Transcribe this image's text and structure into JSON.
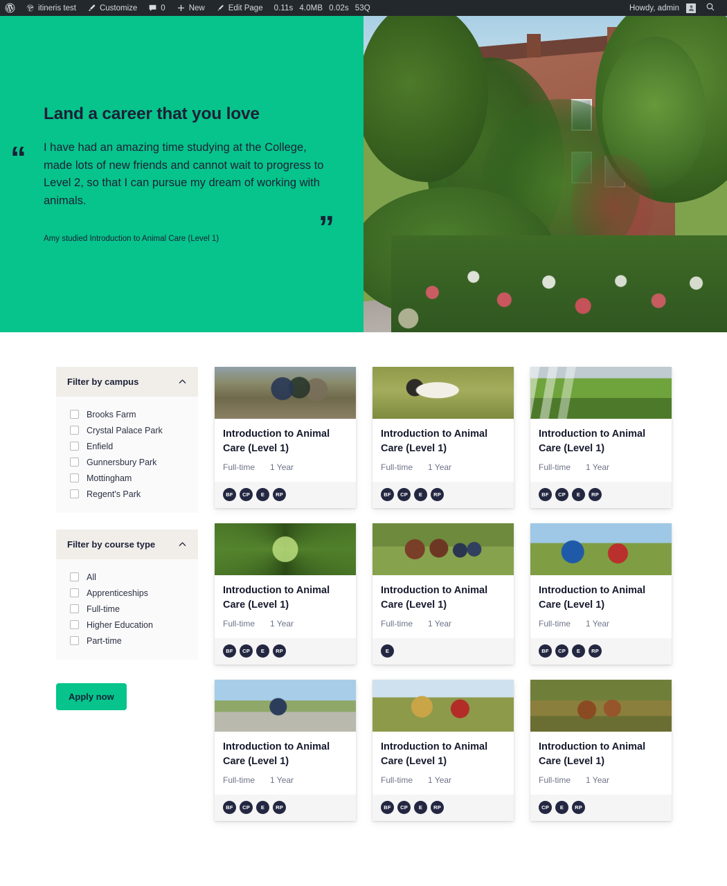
{
  "adminbar": {
    "wp_logo": "wordpress-logo-icon",
    "site_name": "itineris test",
    "site_icon": "dashboard-icon",
    "customize": "Customize",
    "customize_icon": "paintbrush-icon",
    "comments_count": "0",
    "comments_icon": "comment-bubble-icon",
    "new": "New",
    "new_icon": "plus-icon",
    "edit_page": "Edit Page",
    "edit_icon": "pencil-icon",
    "perf": [
      "0.11s",
      "4.0MB",
      "0.02s",
      "53Q"
    ],
    "howdy": "Howdy, admin",
    "avatar_icon": "user-avatar-icon",
    "search_icon": "search-icon"
  },
  "hero": {
    "title": "Land a career that you love",
    "quote_open": "“",
    "quote_close": "”",
    "quote": "I have had an amazing time studying at the College, made lots of new friends and cannot wait to progress to Level 2, so that I can pursue my dream of working with animals.",
    "attribution": "Amy studied Introduction to Animal Care (Level 1)",
    "bg_color": "#06c48b",
    "image_alt": "ivy-covered-brick-college-building-with-flower-garden"
  },
  "filters": [
    {
      "id": "campus",
      "title": "Filter by campus",
      "collapse_icon": "chevron-up-icon",
      "options": [
        {
          "label": "Brooks Farm",
          "checked": false
        },
        {
          "label": "Crystal Palace Park",
          "checked": false
        },
        {
          "label": "Enfield",
          "checked": false
        },
        {
          "label": "Gunnersbury Park",
          "checked": false
        },
        {
          "label": "Mottingham",
          "checked": false
        },
        {
          "label": "Regent's Park",
          "checked": false
        }
      ]
    },
    {
      "id": "course-type",
      "title": "Filter by course type",
      "collapse_icon": "chevron-up-icon",
      "options": [
        {
          "label": "All",
          "checked": false
        },
        {
          "label": "Apprenticeships",
          "checked": false
        },
        {
          "label": "Full-time",
          "checked": false
        },
        {
          "label": "Higher Education",
          "checked": false
        },
        {
          "label": "Part-time",
          "checked": false
        }
      ]
    }
  ],
  "apply_button": "Apply now",
  "courses": [
    {
      "title": "Introduction to Animal Care (Level 1)",
      "type": "Full-time",
      "duration": "1 Year",
      "campuses": [
        "BF",
        "CP",
        "E",
        "RP"
      ],
      "image": "p-students"
    },
    {
      "title": "Introduction to Animal Care (Level 1)",
      "type": "Full-time",
      "duration": "1 Year",
      "campuses": [
        "BF",
        "CP",
        "E",
        "RP"
      ],
      "image": "p-sheep"
    },
    {
      "title": "Introduction to Animal Care (Level 1)",
      "type": "Full-time",
      "duration": "1 Year",
      "campuses": [
        "BF",
        "CP",
        "E",
        "RP"
      ],
      "image": "p-greenhouse"
    },
    {
      "title": "Introduction to Animal Care (Level 1)",
      "type": "Full-time",
      "duration": "1 Year",
      "campuses": [
        "BF",
        "CP",
        "E",
        "RP"
      ],
      "image": "p-forest"
    },
    {
      "title": "Introduction to Animal Care (Level 1)",
      "type": "Full-time",
      "duration": "1 Year",
      "campuses": [
        "E"
      ],
      "image": "p-cattle"
    },
    {
      "title": "Introduction to Animal Care (Level 1)",
      "type": "Full-time",
      "duration": "1 Year",
      "campuses": [
        "BF",
        "CP",
        "E",
        "RP"
      ],
      "image": "p-tractor"
    },
    {
      "title": "Introduction to Animal Care (Level 1)",
      "type": "Full-time",
      "duration": "1 Year",
      "campuses": [
        "BF",
        "CP",
        "E",
        "RP"
      ],
      "image": "p-field-person"
    },
    {
      "title": "Introduction to Animal Care (Level 1)",
      "type": "Full-time",
      "duration": "1 Year",
      "campuses": [
        "BF",
        "CP",
        "E",
        "RP"
      ],
      "image": "p-hay"
    },
    {
      "title": "Introduction to Animal Care (Level 1)",
      "type": "Full-time",
      "duration": "1 Year",
      "campuses": [
        "CP",
        "E",
        "RP"
      ],
      "image": "p-cows"
    }
  ]
}
